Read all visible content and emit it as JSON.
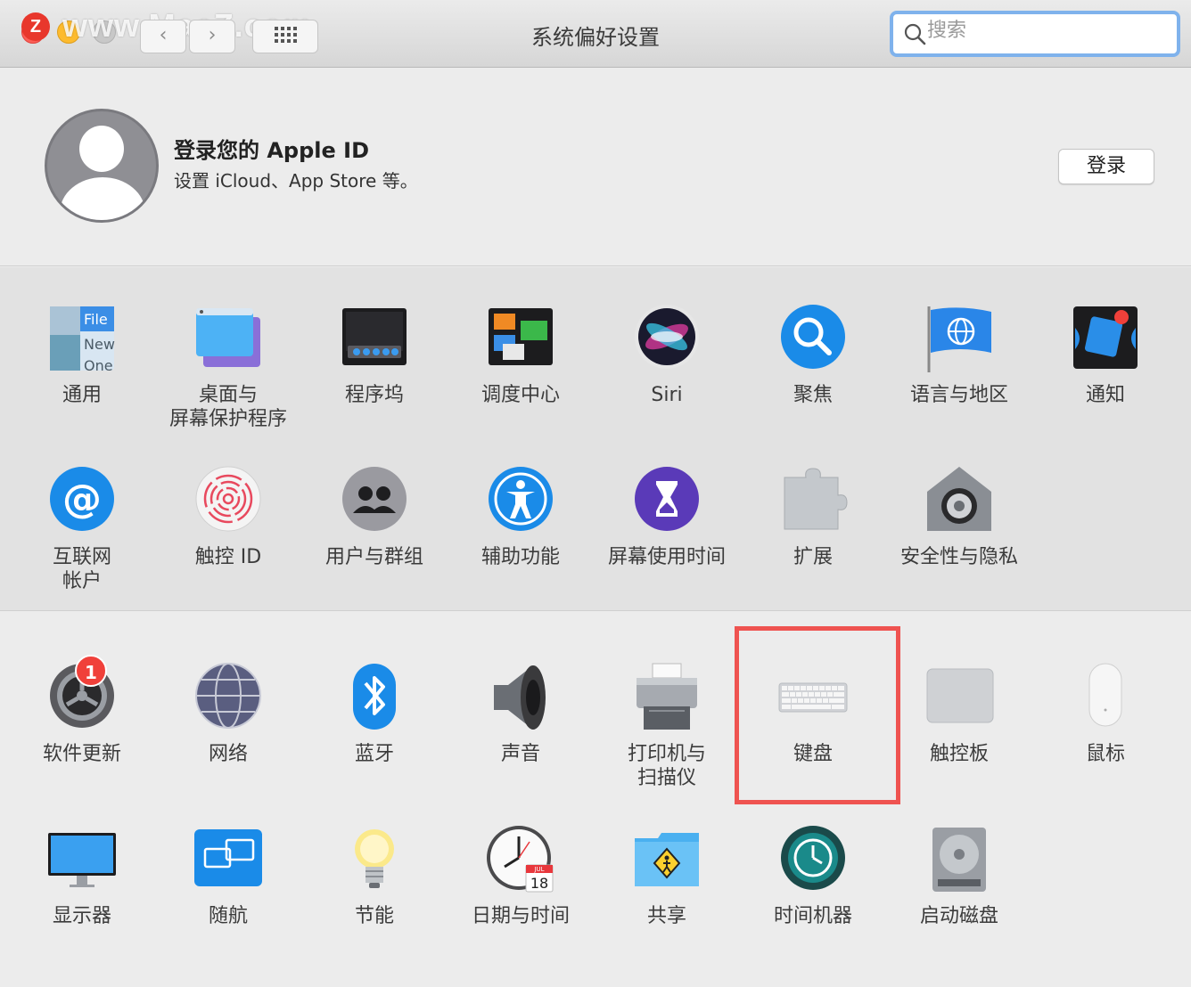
{
  "window": {
    "title": "系统偏好设置",
    "watermark": "www.MacZ.com",
    "badge_letter": "Z"
  },
  "search": {
    "placeholder": "搜索",
    "value": ""
  },
  "apple_id": {
    "title": "登录您的 Apple ID",
    "subtitle": "设置 iCloud、App Store 等。",
    "login_label": "登录"
  },
  "section1": {
    "row1": [
      {
        "label": "通用",
        "icon": "general-icon"
      },
      {
        "label": "桌面与\n屏幕保护程序",
        "icon": "desktop-screensaver-icon"
      },
      {
        "label": "程序坞",
        "icon": "dock-icon"
      },
      {
        "label": "调度中心",
        "icon": "mission-control-icon"
      },
      {
        "label": "Siri",
        "icon": "siri-icon"
      },
      {
        "label": "聚焦",
        "icon": "spotlight-icon"
      },
      {
        "label": "语言与地区",
        "icon": "language-region-icon"
      },
      {
        "label": "通知",
        "icon": "notifications-icon"
      }
    ],
    "row2": [
      {
        "label": "互联网\n帐户",
        "icon": "internet-accounts-icon"
      },
      {
        "label": "触控 ID",
        "icon": "touch-id-icon"
      },
      {
        "label": "用户与群组",
        "icon": "users-groups-icon"
      },
      {
        "label": "辅助功能",
        "icon": "accessibility-icon"
      },
      {
        "label": "屏幕使用时间",
        "icon": "screen-time-icon"
      },
      {
        "label": "扩展",
        "icon": "extensions-icon"
      },
      {
        "label": "安全性与隐私",
        "icon": "security-privacy-icon"
      }
    ]
  },
  "section2": {
    "row1": [
      {
        "label": "软件更新",
        "icon": "software-update-icon",
        "badge": "1"
      },
      {
        "label": "网络",
        "icon": "network-icon"
      },
      {
        "label": "蓝牙",
        "icon": "bluetooth-icon"
      },
      {
        "label": "声音",
        "icon": "sound-icon"
      },
      {
        "label": "打印机与\n扫描仪",
        "icon": "printers-scanners-icon"
      },
      {
        "label": "键盘",
        "icon": "keyboard-icon"
      },
      {
        "label": "触控板",
        "icon": "trackpad-icon"
      },
      {
        "label": "鼠标",
        "icon": "mouse-icon"
      }
    ],
    "row2": [
      {
        "label": "显示器",
        "icon": "displays-icon"
      },
      {
        "label": "随航",
        "icon": "sidecar-icon"
      },
      {
        "label": "节能",
        "icon": "energy-saver-icon"
      },
      {
        "label": "日期与时间",
        "icon": "date-time-icon",
        "calendar_month": "JUL",
        "calendar_day": "18"
      },
      {
        "label": "共享",
        "icon": "sharing-icon"
      },
      {
        "label": "时间机器",
        "icon": "time-machine-icon"
      },
      {
        "label": "启动磁盘",
        "icon": "startup-disk-icon"
      }
    ]
  },
  "general_icon_text": [
    "File",
    "New",
    "One"
  ],
  "highlighted_pane": "键盘",
  "colors": {
    "highlight": "#ef5350",
    "search_ring": "#7fb2ec",
    "badge": "#f0403a"
  }
}
